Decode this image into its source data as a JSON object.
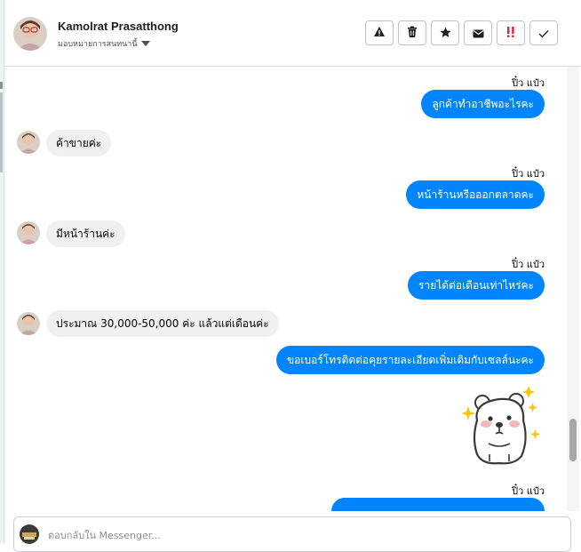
{
  "header": {
    "contact_name": "Kamolrat Prasatthong",
    "assign_label": "มอบหมายการสนทนานี้",
    "toolbar": [
      "warning-icon",
      "trash-icon",
      "star-icon",
      "envelope-icon",
      "important-icon",
      "check-icon"
    ]
  },
  "messages": [
    {
      "direction": "out",
      "sender": "ปิ๋ว แป๋ว",
      "text": "ลูกค้าทำอาชีพอะไรคะ"
    },
    {
      "direction": "in",
      "text": "ค้าขายค่ะ"
    },
    {
      "direction": "out",
      "sender": "ปิ๋ว แป๋ว",
      "text": "หน้าร้านหรือออกตลาดคะ"
    },
    {
      "direction": "in",
      "text": "มีหน้าร้านค่ะ"
    },
    {
      "direction": "out",
      "sender": "ปิ๋ว แป๋ว",
      "text": "รายได้ต่อเดือนเท่าไหร่คะ"
    },
    {
      "direction": "in",
      "text": "ประมาณ 30,000-50,000 ค่ะ แล้วแต่เดือนค่ะ"
    },
    {
      "direction": "out",
      "text": "ขอเบอร์โทรติดต่อคุยรายละเอียดเพิ่มเติมกับเซลล์นะคะ"
    },
    {
      "direction": "out",
      "type": "sticker",
      "sticker": "hamster-sticker"
    },
    {
      "direction": "out",
      "sender": "ปิ๋ว แป๋ว"
    }
  ],
  "composer": {
    "placeholder": "ตอบกลับใน Messenger..."
  },
  "colors": {
    "outgoing_bubble": "#0084ff",
    "incoming_bubble": "#f0f0f0",
    "important_icon": "#e41e3f"
  }
}
